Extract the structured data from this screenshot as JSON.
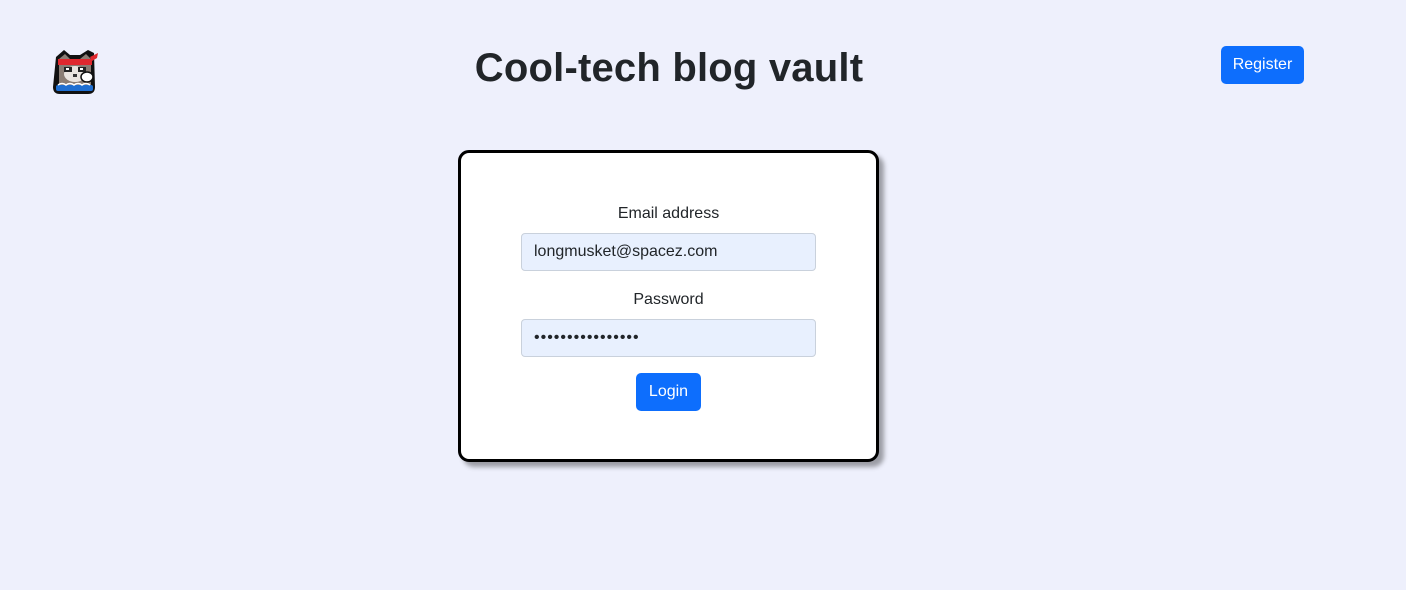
{
  "header": {
    "title": "Cool-tech blog vault",
    "register_label": "Register"
  },
  "login_form": {
    "email_label": "Email address",
    "email_value": "longmusket@spacez.com",
    "password_label": "Password",
    "password_value": "••••••••••••••••",
    "login_label": "Login"
  },
  "icons": {
    "logo": "ninja-cat-logo-icon"
  },
  "colors": {
    "background": "#eef0fc",
    "primary_button": "#0d6efd",
    "input_background": "#e8f0fe",
    "card_border": "#000000"
  }
}
